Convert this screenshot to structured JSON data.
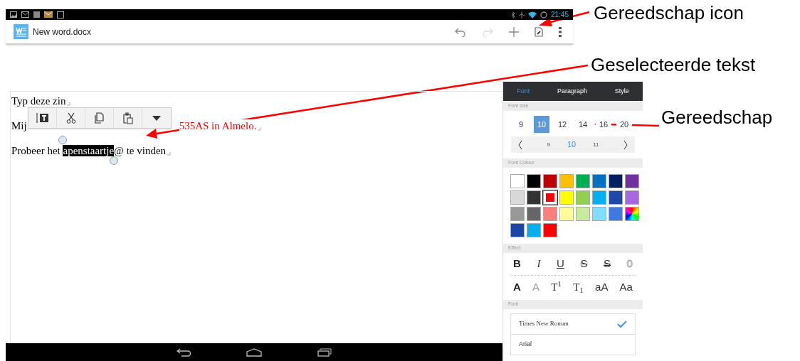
{
  "status_bar": {
    "time": "21:45"
  },
  "app_bar": {
    "title": "New word.docx"
  },
  "document": {
    "lines": [
      {
        "segments": [
          {
            "text": "Typ deze zin",
            "selected": false,
            "color": "#000000"
          }
        ]
      },
      {
        "segments": [
          {
            "text": "Mij",
            "selected": false,
            "color": "#000000"
          },
          {
            "text": "535AS in Almelo.",
            "selected": false,
            "color": "#ff0000"
          }
        ]
      },
      {
        "segments": [
          {
            "text": "Probeer het ",
            "selected": false,
            "color": "#000000"
          },
          {
            "text": "apenstaartje",
            "selected": true,
            "color": "#000000"
          },
          {
            "text": "@ te vinden",
            "selected": false,
            "color": "#000000"
          }
        ]
      }
    ]
  },
  "panel": {
    "tabs": [
      {
        "label": "Font",
        "selected": true
      },
      {
        "label": "Paragraph",
        "selected": false
      },
      {
        "label": "Style",
        "selected": false
      }
    ],
    "font_size": {
      "header": "Font size",
      "sizes": [
        {
          "label": "9",
          "selected": false
        },
        {
          "label": "10",
          "selected": true
        },
        {
          "label": "12",
          "selected": false
        },
        {
          "label": "14",
          "selected": false
        },
        {
          "label": "16",
          "selected": false
        },
        {
          "label": "20",
          "selected": false
        }
      ],
      "stepper": [
        {
          "label": "9",
          "selected": false
        },
        {
          "label": "10",
          "selected": true
        },
        {
          "label": "11",
          "selected": false
        }
      ]
    },
    "font_colour": {
      "header": "Font Colour",
      "swatches": [
        {
          "kind": "plain",
          "color": "#ffffff",
          "selected": false
        },
        {
          "kind": "plain",
          "color": "#000000",
          "selected": false
        },
        {
          "kind": "plain",
          "color": "#c00000",
          "selected": false
        },
        {
          "kind": "plain",
          "color": "#ffc000",
          "selected": false
        },
        {
          "kind": "plain",
          "color": "#00b050",
          "selected": false
        },
        {
          "kind": "plain",
          "color": "#0070c0",
          "selected": false
        },
        {
          "kind": "plain",
          "color": "#002060",
          "selected": false
        },
        {
          "kind": "plain",
          "color": "#7030a0",
          "selected": false
        },
        {
          "kind": "plain",
          "color": "#d9d9d9",
          "selected": false
        },
        {
          "kind": "plain",
          "color": "#333333",
          "selected": false
        },
        {
          "kind": "plain",
          "color": "#ff0000",
          "selected": true
        },
        {
          "kind": "plain",
          "color": "#ffff00",
          "selected": false
        },
        {
          "kind": "plain",
          "color": "#92d050",
          "selected": false
        },
        {
          "kind": "plain",
          "color": "#00b0f0",
          "selected": false
        },
        {
          "kind": "plain",
          "color": "#1f48a8",
          "selected": false
        },
        {
          "kind": "plain",
          "color": "#a866e0",
          "selected": false
        },
        {
          "kind": "plain",
          "color": "#999999",
          "selected": false
        },
        {
          "kind": "plain",
          "color": "#666666",
          "selected": false
        },
        {
          "kind": "plain",
          "color": "#ff7f7f",
          "selected": false
        },
        {
          "kind": "plain",
          "color": "#ffff99",
          "selected": false
        },
        {
          "kind": "plain",
          "color": "#c6eb9e",
          "selected": false
        },
        {
          "kind": "plain",
          "color": "#80dfff",
          "selected": false
        },
        {
          "kind": "plain",
          "color": "#3d7ae0",
          "selected": false
        },
        {
          "kind": "custom",
          "selected": false
        },
        {
          "kind": "plain",
          "color": "#1a46a8",
          "selected": false
        },
        {
          "kind": "plain",
          "color": "#00b0f0",
          "selected": false
        },
        {
          "kind": "plain",
          "color": "#ff0000",
          "selected": false
        }
      ]
    },
    "effect": {
      "header": "Effect",
      "rows": [
        [
          {
            "kind": "bold",
            "label": "B"
          },
          {
            "kind": "italic",
            "label": "I"
          },
          {
            "kind": "underline",
            "label": "U"
          },
          {
            "kind": "strike",
            "label": "S"
          },
          {
            "kind": "double_strike",
            "label": "S"
          },
          {
            "kind": "outline",
            "label": "0"
          }
        ],
        [
          {
            "kind": "shadow",
            "label": "A"
          },
          {
            "kind": "hollow",
            "label": "A"
          },
          {
            "kind": "superscript",
            "label": "T$^{1}$"
          },
          {
            "kind": "subscript",
            "label": "T$_{1}$"
          },
          {
            "kind": "lower",
            "label": "aA"
          },
          {
            "kind": "title",
            "label": "Aa"
          }
        ]
      ]
    },
    "font": {
      "header": "Font",
      "items": [
        {
          "label": "Times New Roman",
          "selected": true
        },
        {
          "label": "Arial",
          "selected": false
        }
      ]
    }
  },
  "annotations": [
    {
      "text": "Gereedschap icon"
    },
    {
      "text": "Geselecteerde tekst"
    },
    {
      "text": "Gereedschap"
    }
  ]
}
